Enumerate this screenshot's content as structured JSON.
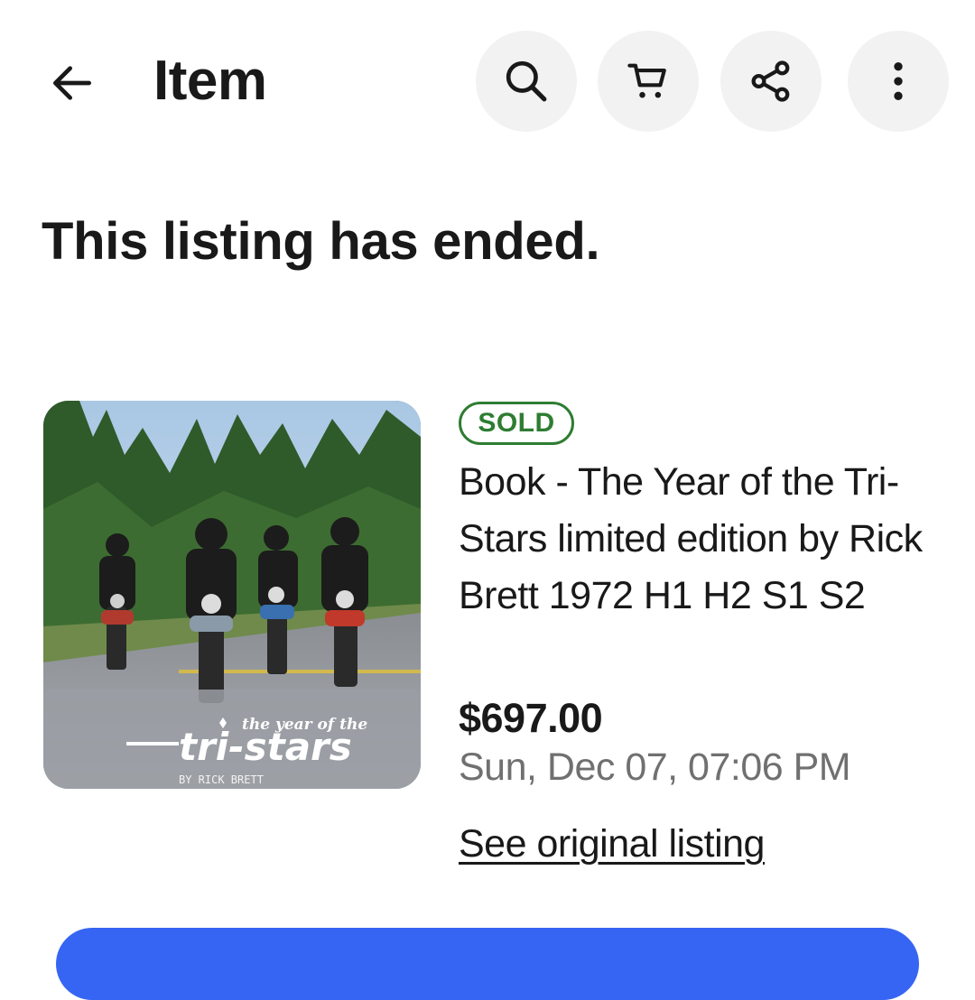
{
  "header": {
    "title": "Item",
    "icons": [
      "back-arrow-icon",
      "search-icon",
      "cart-icon",
      "share-icon",
      "more-vertical-icon"
    ]
  },
  "banner": {
    "text": "This listing has ended."
  },
  "item": {
    "status_badge": "SOLD",
    "title": "Book - The Year of the Tri-Stars limited edition by Rick Brett 1972 H1 H2 S1 S2",
    "price": "$697.00",
    "sold_date": "Sun, Dec 07, 07:06 PM",
    "link_label": "See original listing",
    "image": {
      "cover_small": "the year of the",
      "cover_big": "tri-stars",
      "cover_author": "BY RICK BRETT"
    }
  },
  "colors": {
    "sold_green": "#2e7d32",
    "secondary_text": "#707070",
    "primary_blue": "#3665f3",
    "icon_button_bg": "#f2f2f2"
  }
}
